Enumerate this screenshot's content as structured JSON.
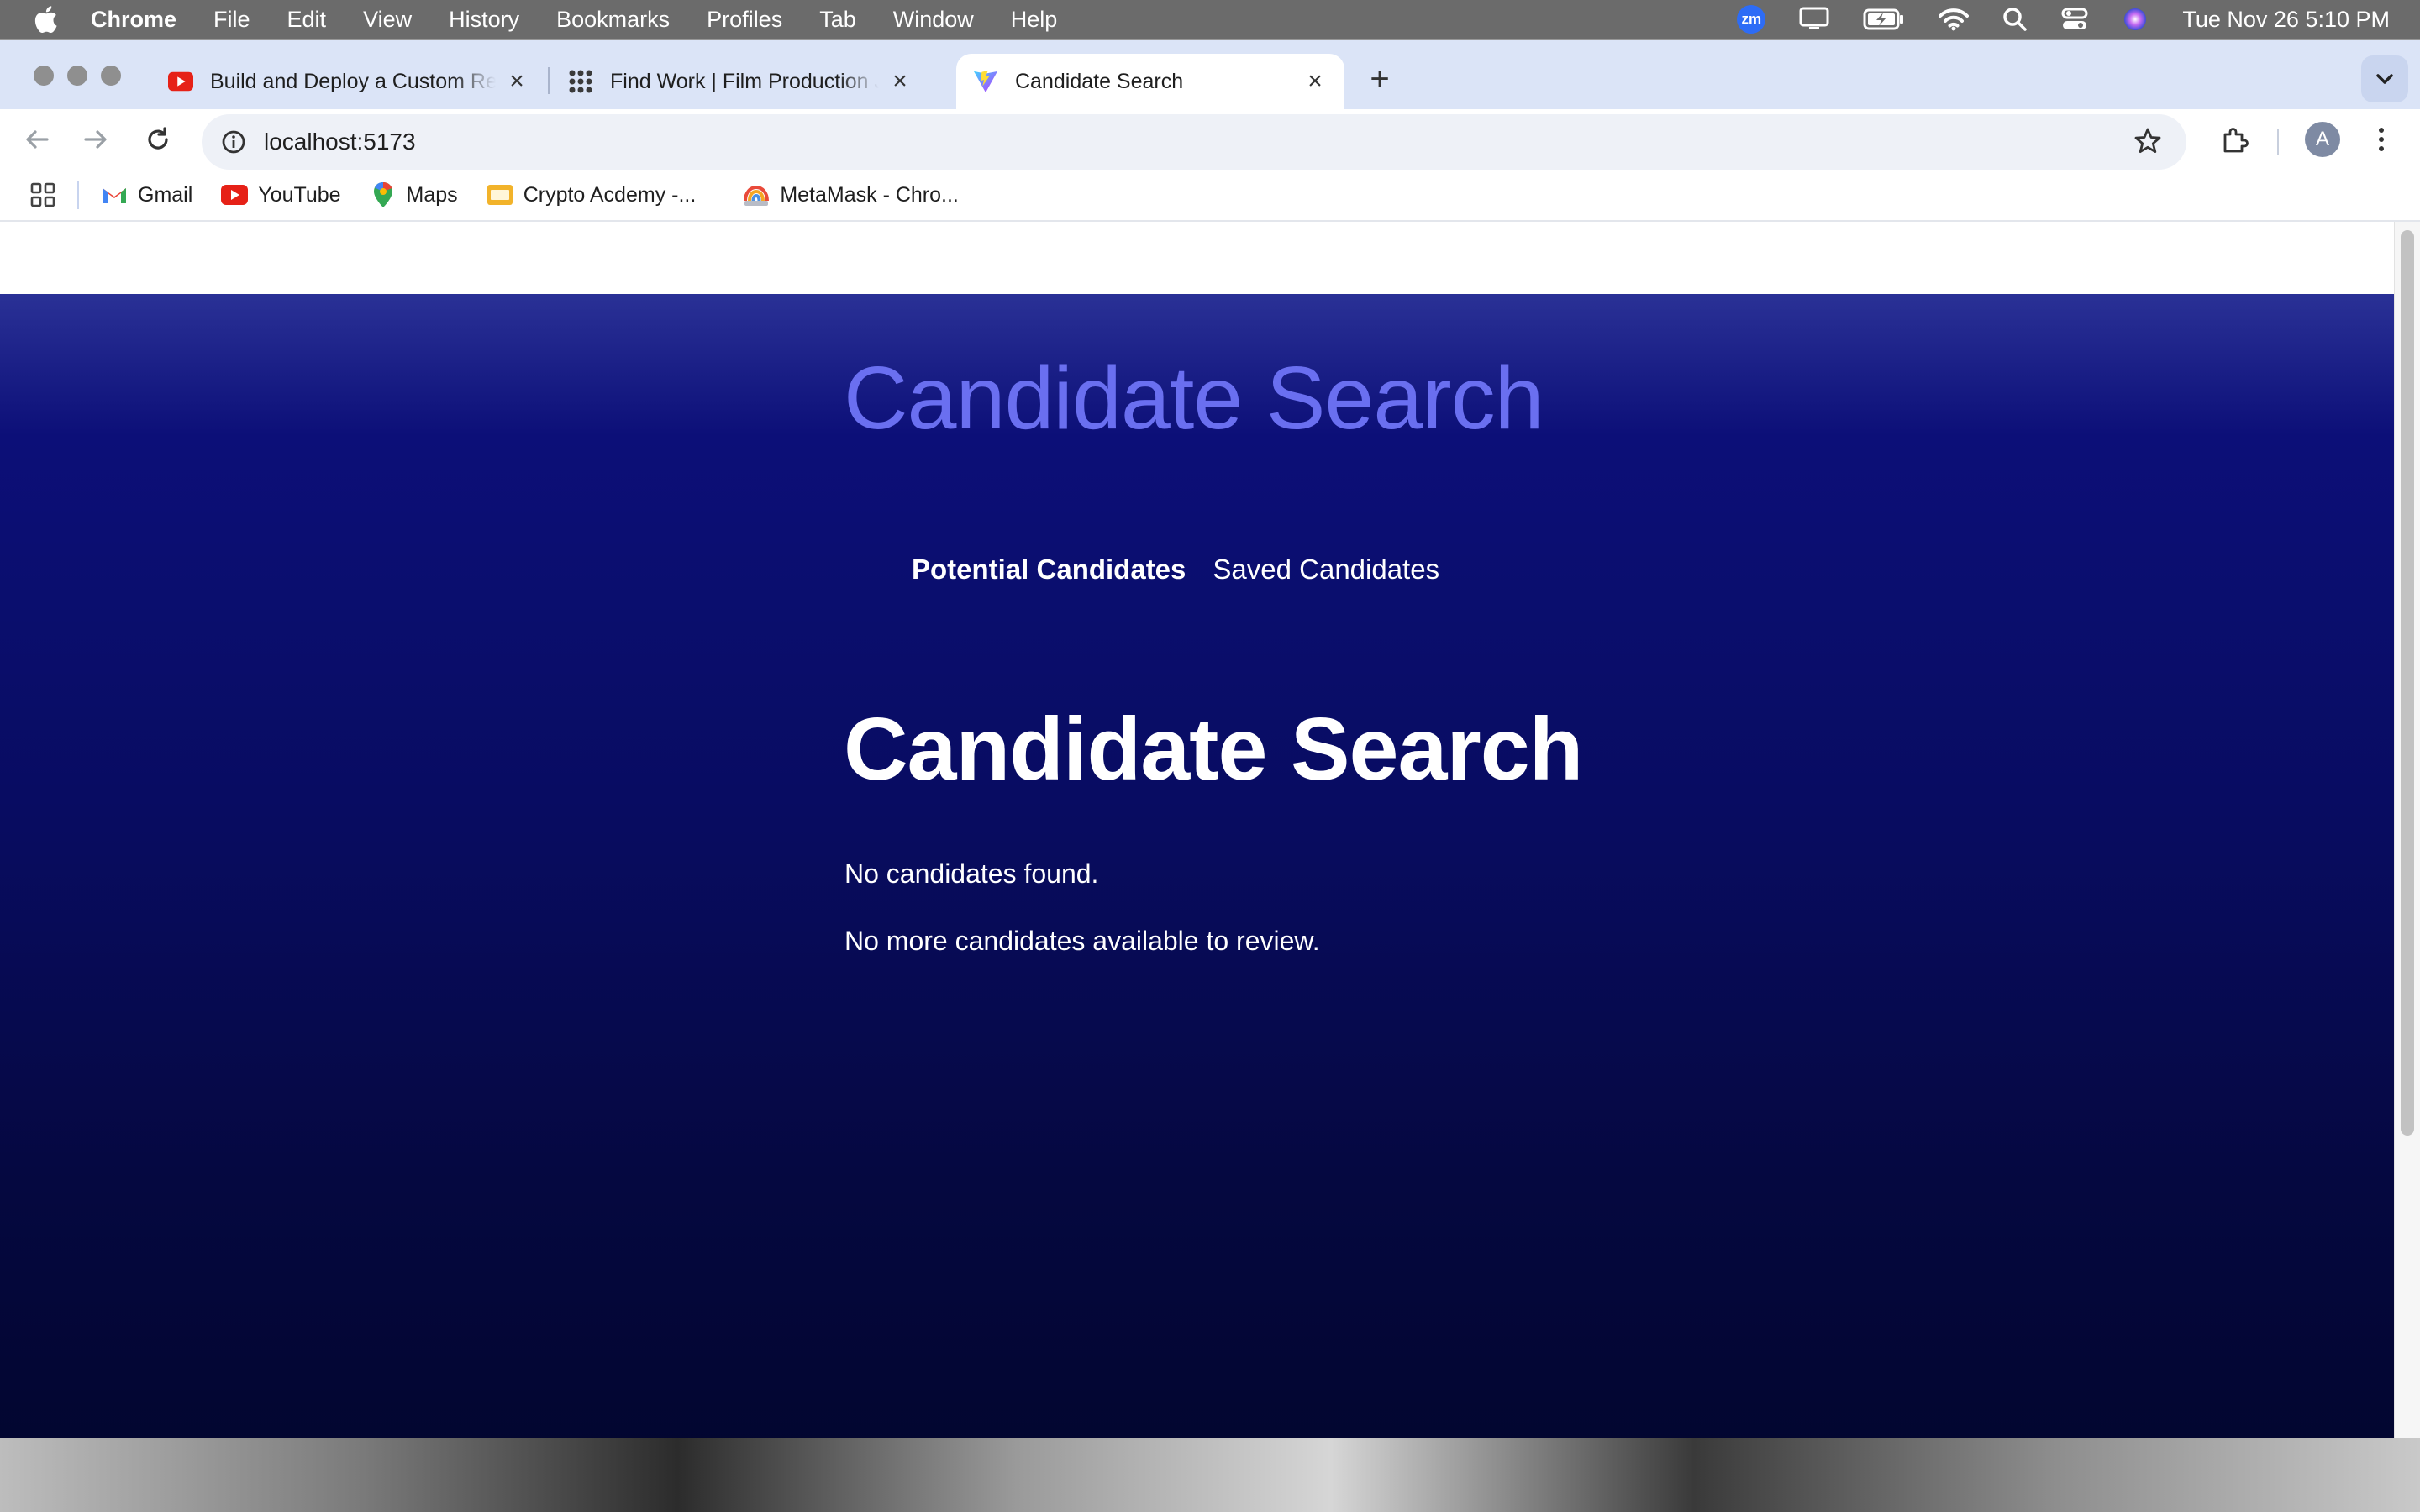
{
  "menubar": {
    "app_name": "Chrome",
    "items": [
      "File",
      "Edit",
      "View",
      "History",
      "Bookmarks",
      "Profiles",
      "Tab",
      "Window",
      "Help"
    ],
    "zoom_badge": "zm",
    "datetime": "Tue Nov 26  5:10 PM"
  },
  "tabs": [
    {
      "title": "Build and Deploy a Custom React",
      "favicon": "youtube-icon",
      "active": false
    },
    {
      "title": "Find Work | Film Production Jobs",
      "favicon": "grid-apps-icon",
      "active": false
    },
    {
      "title": "Candidate Search",
      "favicon": "vite-icon",
      "active": true
    }
  ],
  "toolbar": {
    "url": "localhost:5173",
    "avatar_letter": "A"
  },
  "bookmarks": [
    {
      "label": "Gmail",
      "icon": "gmail-icon"
    },
    {
      "label": "YouTube",
      "icon": "youtube-icon"
    },
    {
      "label": "Maps",
      "icon": "maps-icon"
    },
    {
      "label": "Crypto Acdemy -...",
      "icon": "folder-icon"
    },
    {
      "label": "MetaMask - Chro...",
      "icon": "metamask-icon"
    }
  ],
  "page": {
    "site_title": "Candidate Search",
    "nav": {
      "potential": "Potential Candidates",
      "saved": "Saved Candidates"
    },
    "heading": "Candidate Search",
    "message_empty": "No candidates found.",
    "message_done": "No more candidates available to review."
  },
  "colors": {
    "accent_title": "#6a6ff0",
    "page_bg_top": "#0c0f78",
    "page_bg_bottom": "#02052e",
    "tabstrip": "#dbe4f7"
  }
}
